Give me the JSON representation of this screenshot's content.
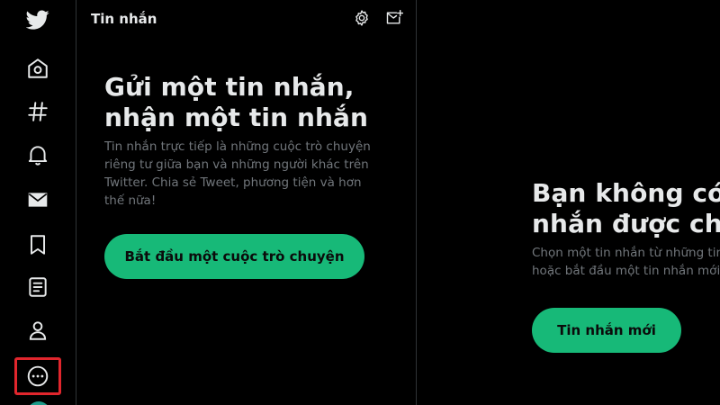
{
  "nav": {
    "items": [
      {
        "icon": "twitter-logo-icon"
      },
      {
        "icon": "home-icon"
      },
      {
        "icon": "explore-hashtag-icon"
      },
      {
        "icon": "notifications-bell-icon"
      },
      {
        "icon": "messages-envelope-icon"
      },
      {
        "icon": "bookmarks-icon"
      },
      {
        "icon": "lists-icon"
      },
      {
        "icon": "profile-icon"
      },
      {
        "icon": "more-options-icon",
        "highlighted": true
      }
    ],
    "highlight_color": "#e1262d"
  },
  "messages": {
    "title": "Tin nhắn",
    "settings_icon": "settings-gear-icon",
    "compose_icon": "new-message-envelope-icon",
    "empty_heading_line1": "Gửi một tin nhắn,",
    "empty_heading_line2": "nhận một tin nhắn",
    "empty_description": "Tin nhắn trực tiếp là những cuộc trò chuyện riêng tư giữa bạn và những người khác trên Twitter. Chia sẻ Tweet, phương tiện và hơn thế nữa!",
    "start_button_label": "Bắt đầu một cuộc trò chuyện"
  },
  "detail": {
    "empty_heading_line1": "Bạn không có tin nhắn nào được chọn",
    "empty_heading_line2": "nhắn được chọn",
    "empty_description": "Chọn một tin nhắn từ những tin nhắn hiện có của bạn, hoặc bắt đầu một tin nhắn mới.",
    "new_message_button_label": "Tin nhắn mới"
  },
  "colors": {
    "background": "#000000",
    "accent_green": "#17b978",
    "text_primary": "#e7e9ea",
    "text_secondary": "#71767b",
    "divider": "#2f3336"
  }
}
